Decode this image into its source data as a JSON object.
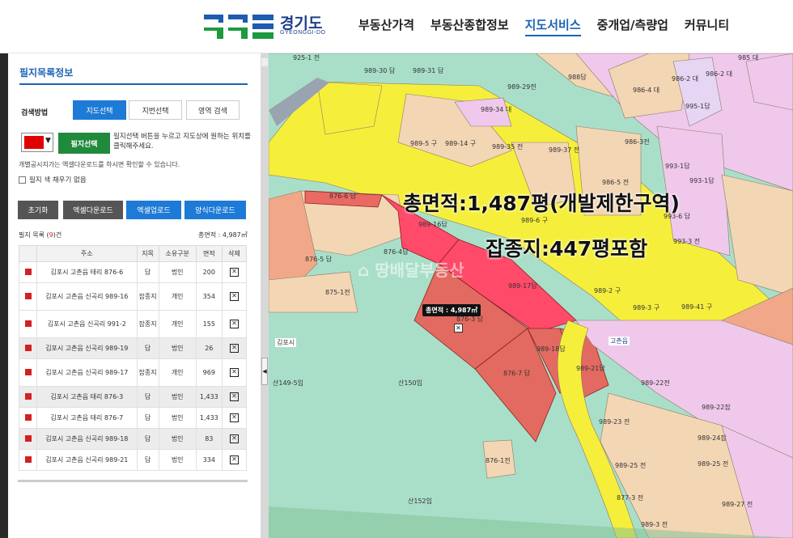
{
  "header": {
    "logo_text": "경기도",
    "logo_sub": "GYEONGGI-DO",
    "nav": [
      {
        "label": "부동산가격"
      },
      {
        "label": "부동산종합정보"
      },
      {
        "label": "지도서비스"
      },
      {
        "label": "중개업/측량업"
      },
      {
        "label": "커뮤니티"
      }
    ]
  },
  "panel": {
    "title": "필지목록정보",
    "search_label": "검색방법",
    "tabs": [
      "지도선택",
      "지번선택",
      "영역 검색"
    ],
    "select_btn": "필지선택",
    "guide1": "필지선택 버튼을 누르고 지도상에 원하는 위치를 클릭해주세요.",
    "guide2": "개별공시지가는 엑셀다운로드를 하시면 확인할 수 있습니다.",
    "fill_label": "필지 색 채우기 없음",
    "buttons": {
      "reset": "초기화",
      "excel_dn": "엑셀다운로드",
      "excel_up": "엑셀업로드",
      "form_dn": "양식다운로드"
    },
    "list_count_prefix": "필지 목록 (",
    "list_count": "9",
    "list_count_suffix": ")건",
    "list_total": "총면적 : 4,987㎡",
    "columns": [
      "주소",
      "지목",
      "소유구분",
      "면적",
      "삭제"
    ],
    "rows": [
      {
        "addr": "김포시 고촌읍 태리 876-6",
        "jimok": "답",
        "owner": "법인",
        "area": "200"
      },
      {
        "addr": "김포시 고촌읍 신곡리 989-16",
        "jimok": "잡종지",
        "owner": "개인",
        "area": "354"
      },
      {
        "addr": "김포시 고촌읍 신곡리 991-2",
        "jimok": "잡종지",
        "owner": "개인",
        "area": "155"
      },
      {
        "addr": "김포시 고촌읍 신곡리 989-19",
        "jimok": "답",
        "owner": "법인",
        "area": "26"
      },
      {
        "addr": "김포시 고촌읍 신곡리 989-17",
        "jimok": "잡종지",
        "owner": "개인",
        "area": "969"
      },
      {
        "addr": "김포시 고촌읍 태리 876-3",
        "jimok": "답",
        "owner": "법인",
        "area": "1,433"
      },
      {
        "addr": "김포시 고촌읍 태리 876-7",
        "jimok": "답",
        "owner": "법인",
        "area": "1,433"
      },
      {
        "addr": "김포시 고촌읍 신곡리 989-18",
        "jimok": "답",
        "owner": "법인",
        "area": "83"
      },
      {
        "addr": "김포시 고촌읍 신곡리 989-21",
        "jimok": "답",
        "owner": "법인",
        "area": "334"
      }
    ]
  },
  "map": {
    "overlay1": "총면적:1,487평(개발제한구역)",
    "overlay2": "잡종지:447평포함",
    "callout": "총면적 : 4,987㎡",
    "watermark": "⌂ 땅배달부동산",
    "tag_gimpo": "김포시",
    "tag_gochon": "고촌읍",
    "parcels": [
      "925-1 전",
      "989-30 답",
      "989-31 답",
      "988답",
      "985 대",
      "986-4 대",
      "986-2 대",
      "986-2 대",
      "989-29전",
      "989-34 대",
      "995-1답",
      "989-5 구",
      "989-14 구",
      "989-35 전",
      "989-37 전",
      "986-3전",
      "993-1답",
      "986-5 전",
      "993-1답",
      "876-6 답",
      "989-16답",
      "989-6 구",
      "993-6 답",
      "993-3 전",
      "876-4답",
      "876-5 답",
      "989-17답",
      "989-2 구",
      "875-1전",
      "989-3 구",
      "989-41 구",
      "876-3 답",
      "989-18답",
      "989-21답",
      "876-7 답",
      "산150임",
      "산149-5임",
      "989-22전",
      "989-22잡",
      "989-23 전",
      "989-24잡",
      "989-25 전",
      "989-25 전",
      "876-1전",
      "산152임",
      "989-27 전",
      "877-3 전",
      "989-3 전"
    ]
  },
  "colors": {
    "accent": "#1d63b5",
    "select_green": "#1f8a3c",
    "parcel_red": "#e00000",
    "zone_yellow": "#f5f03a"
  }
}
